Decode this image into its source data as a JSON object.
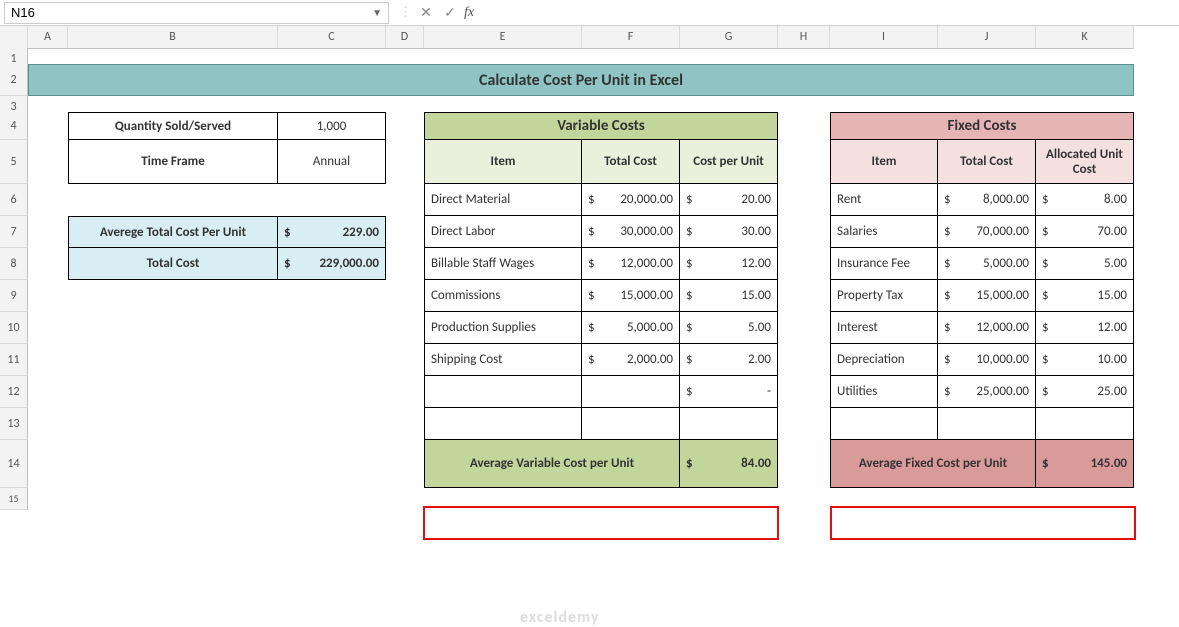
{
  "namebox": "N16",
  "formula_bar": "",
  "columns": [
    "A",
    "B",
    "C",
    "D",
    "E",
    "F",
    "G",
    "H",
    "I",
    "J",
    "K"
  ],
  "rows": [
    "1",
    "2",
    "3",
    "4",
    "5",
    "6",
    "7",
    "8",
    "9",
    "10",
    "11",
    "12",
    "13",
    "14",
    "15"
  ],
  "title": "Calculate Cost Per Unit in Excel",
  "qty_label": "Quantity Sold/Served",
  "qty_value": "1,000",
  "timeframe_label": "Time Frame",
  "timeframe_value": "Annual",
  "summary": {
    "avg_label": "Averege Total Cost Per Unit",
    "avg_sym": "$",
    "avg_val": "229.00",
    "total_label": "Total Cost",
    "total_sym": "$",
    "total_val": "229,000.00"
  },
  "variable": {
    "header": "Variable Costs",
    "cols": [
      "Item",
      "Total Cost",
      "Cost per Unit"
    ],
    "rows": [
      {
        "item": "Direct Material",
        "tc_sym": "$",
        "tc": "20,000.00",
        "cu_sym": "$",
        "cu": "20.00"
      },
      {
        "item": "Direct Labor",
        "tc_sym": "$",
        "tc": "30,000.00",
        "cu_sym": "$",
        "cu": "30.00"
      },
      {
        "item": "Billable Staff Wages",
        "tc_sym": "$",
        "tc": "12,000.00",
        "cu_sym": "$",
        "cu": "12.00"
      },
      {
        "item": "Commissions",
        "tc_sym": "$",
        "tc": "15,000.00",
        "cu_sym": "$",
        "cu": "15.00"
      },
      {
        "item": "Production Supplies",
        "tc_sym": "$",
        "tc": "5,000.00",
        "cu_sym": "$",
        "cu": "5.00"
      },
      {
        "item": "Shipping Cost",
        "tc_sym": "$",
        "tc": "2,000.00",
        "cu_sym": "$",
        "cu": "2.00"
      },
      {
        "item": "",
        "tc_sym": "",
        "tc": "",
        "cu_sym": "$",
        "cu": "-"
      },
      {
        "item": "",
        "tc_sym": "",
        "tc": "",
        "cu_sym": "",
        "cu": ""
      }
    ],
    "footer_label": "Average Variable Cost per Unit",
    "footer_sym": "$",
    "footer_val": "84.00"
  },
  "fixed": {
    "header": "Fixed Costs",
    "cols": [
      "Item",
      "Total Cost",
      "Allocated Unit Cost"
    ],
    "rows": [
      {
        "item": "Rent",
        "tc_sym": "$",
        "tc": "8,000.00",
        "cu_sym": "$",
        "cu": "8.00"
      },
      {
        "item": "Salaries",
        "tc_sym": "$",
        "tc": "70,000.00",
        "cu_sym": "$",
        "cu": "70.00"
      },
      {
        "item": "Insurance Fee",
        "tc_sym": "$",
        "tc": "5,000.00",
        "cu_sym": "$",
        "cu": "5.00"
      },
      {
        "item": "Property Tax",
        "tc_sym": "$",
        "tc": "15,000.00",
        "cu_sym": "$",
        "cu": "15.00"
      },
      {
        "item": "Interest",
        "tc_sym": "$",
        "tc": "12,000.00",
        "cu_sym": "$",
        "cu": "12.00"
      },
      {
        "item": "Depreciation",
        "tc_sym": "$",
        "tc": "10,000.00",
        "cu_sym": "$",
        "cu": "10.00"
      },
      {
        "item": "Utilities",
        "tc_sym": "$",
        "tc": "25,000.00",
        "cu_sym": "$",
        "cu": "25.00"
      },
      {
        "item": "",
        "tc_sym": "",
        "tc": "",
        "cu_sym": "",
        "cu": ""
      }
    ],
    "footer_label": "Average Fixed Cost per Unit",
    "footer_sym": "$",
    "footer_val": "145.00"
  },
  "watermark": "exceldemy"
}
